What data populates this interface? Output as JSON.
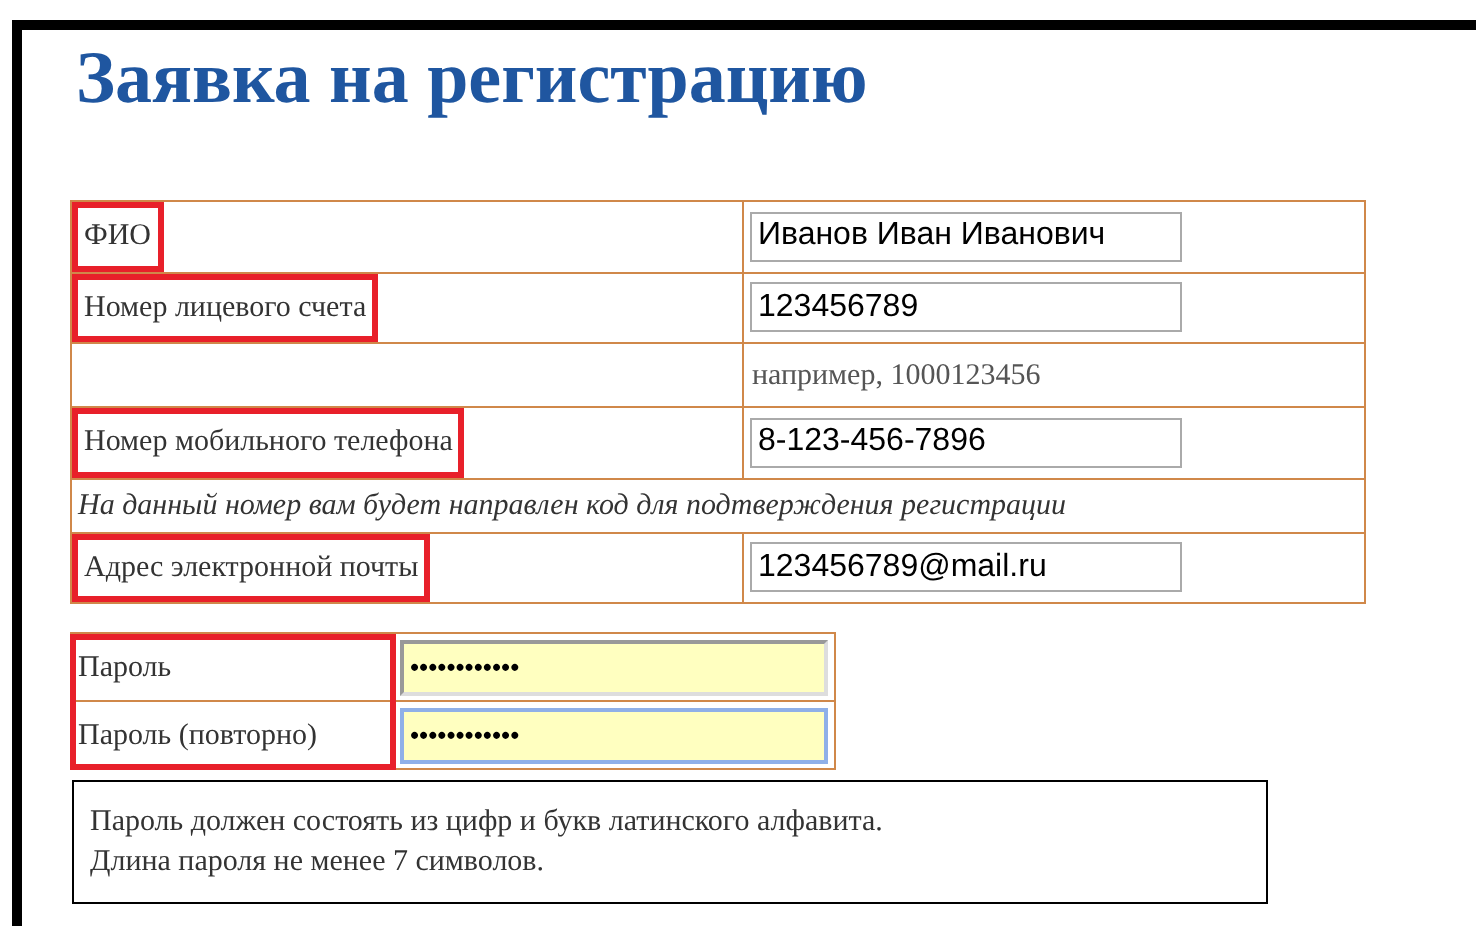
{
  "title": "Заявка на регистрацию",
  "fields": [
    {
      "kind": "input",
      "label": "ФИО",
      "value": "Иванов Иван Иванович",
      "highlighted": true
    },
    {
      "kind": "input",
      "label": "Номер лицевого счета",
      "value": "123456789",
      "highlighted": true
    },
    {
      "kind": "hint",
      "text": "например, 1000123456"
    },
    {
      "kind": "input",
      "label": "Номер мобильного телефона",
      "value": "8-123-456-7896",
      "highlighted": true
    },
    {
      "kind": "note",
      "text": "На данный номер вам будет направлен код для подтверждения регистрации"
    },
    {
      "kind": "input",
      "label": "Адрес электронной почты",
      "value": "123456789@mail.ru",
      "highlighted": true
    }
  ],
  "password": {
    "highlighted": true,
    "rows": [
      {
        "label": "Пароль",
        "value": "••••••••••••",
        "focused": false
      },
      {
        "label": "Пароль (повторно)",
        "value": "••••••••••••",
        "focused": true
      }
    ]
  },
  "rules": [
    "Пароль должен состоять из цифр и букв латинского алфавита.",
    "Длина пароля не менее 7 символов."
  ]
}
